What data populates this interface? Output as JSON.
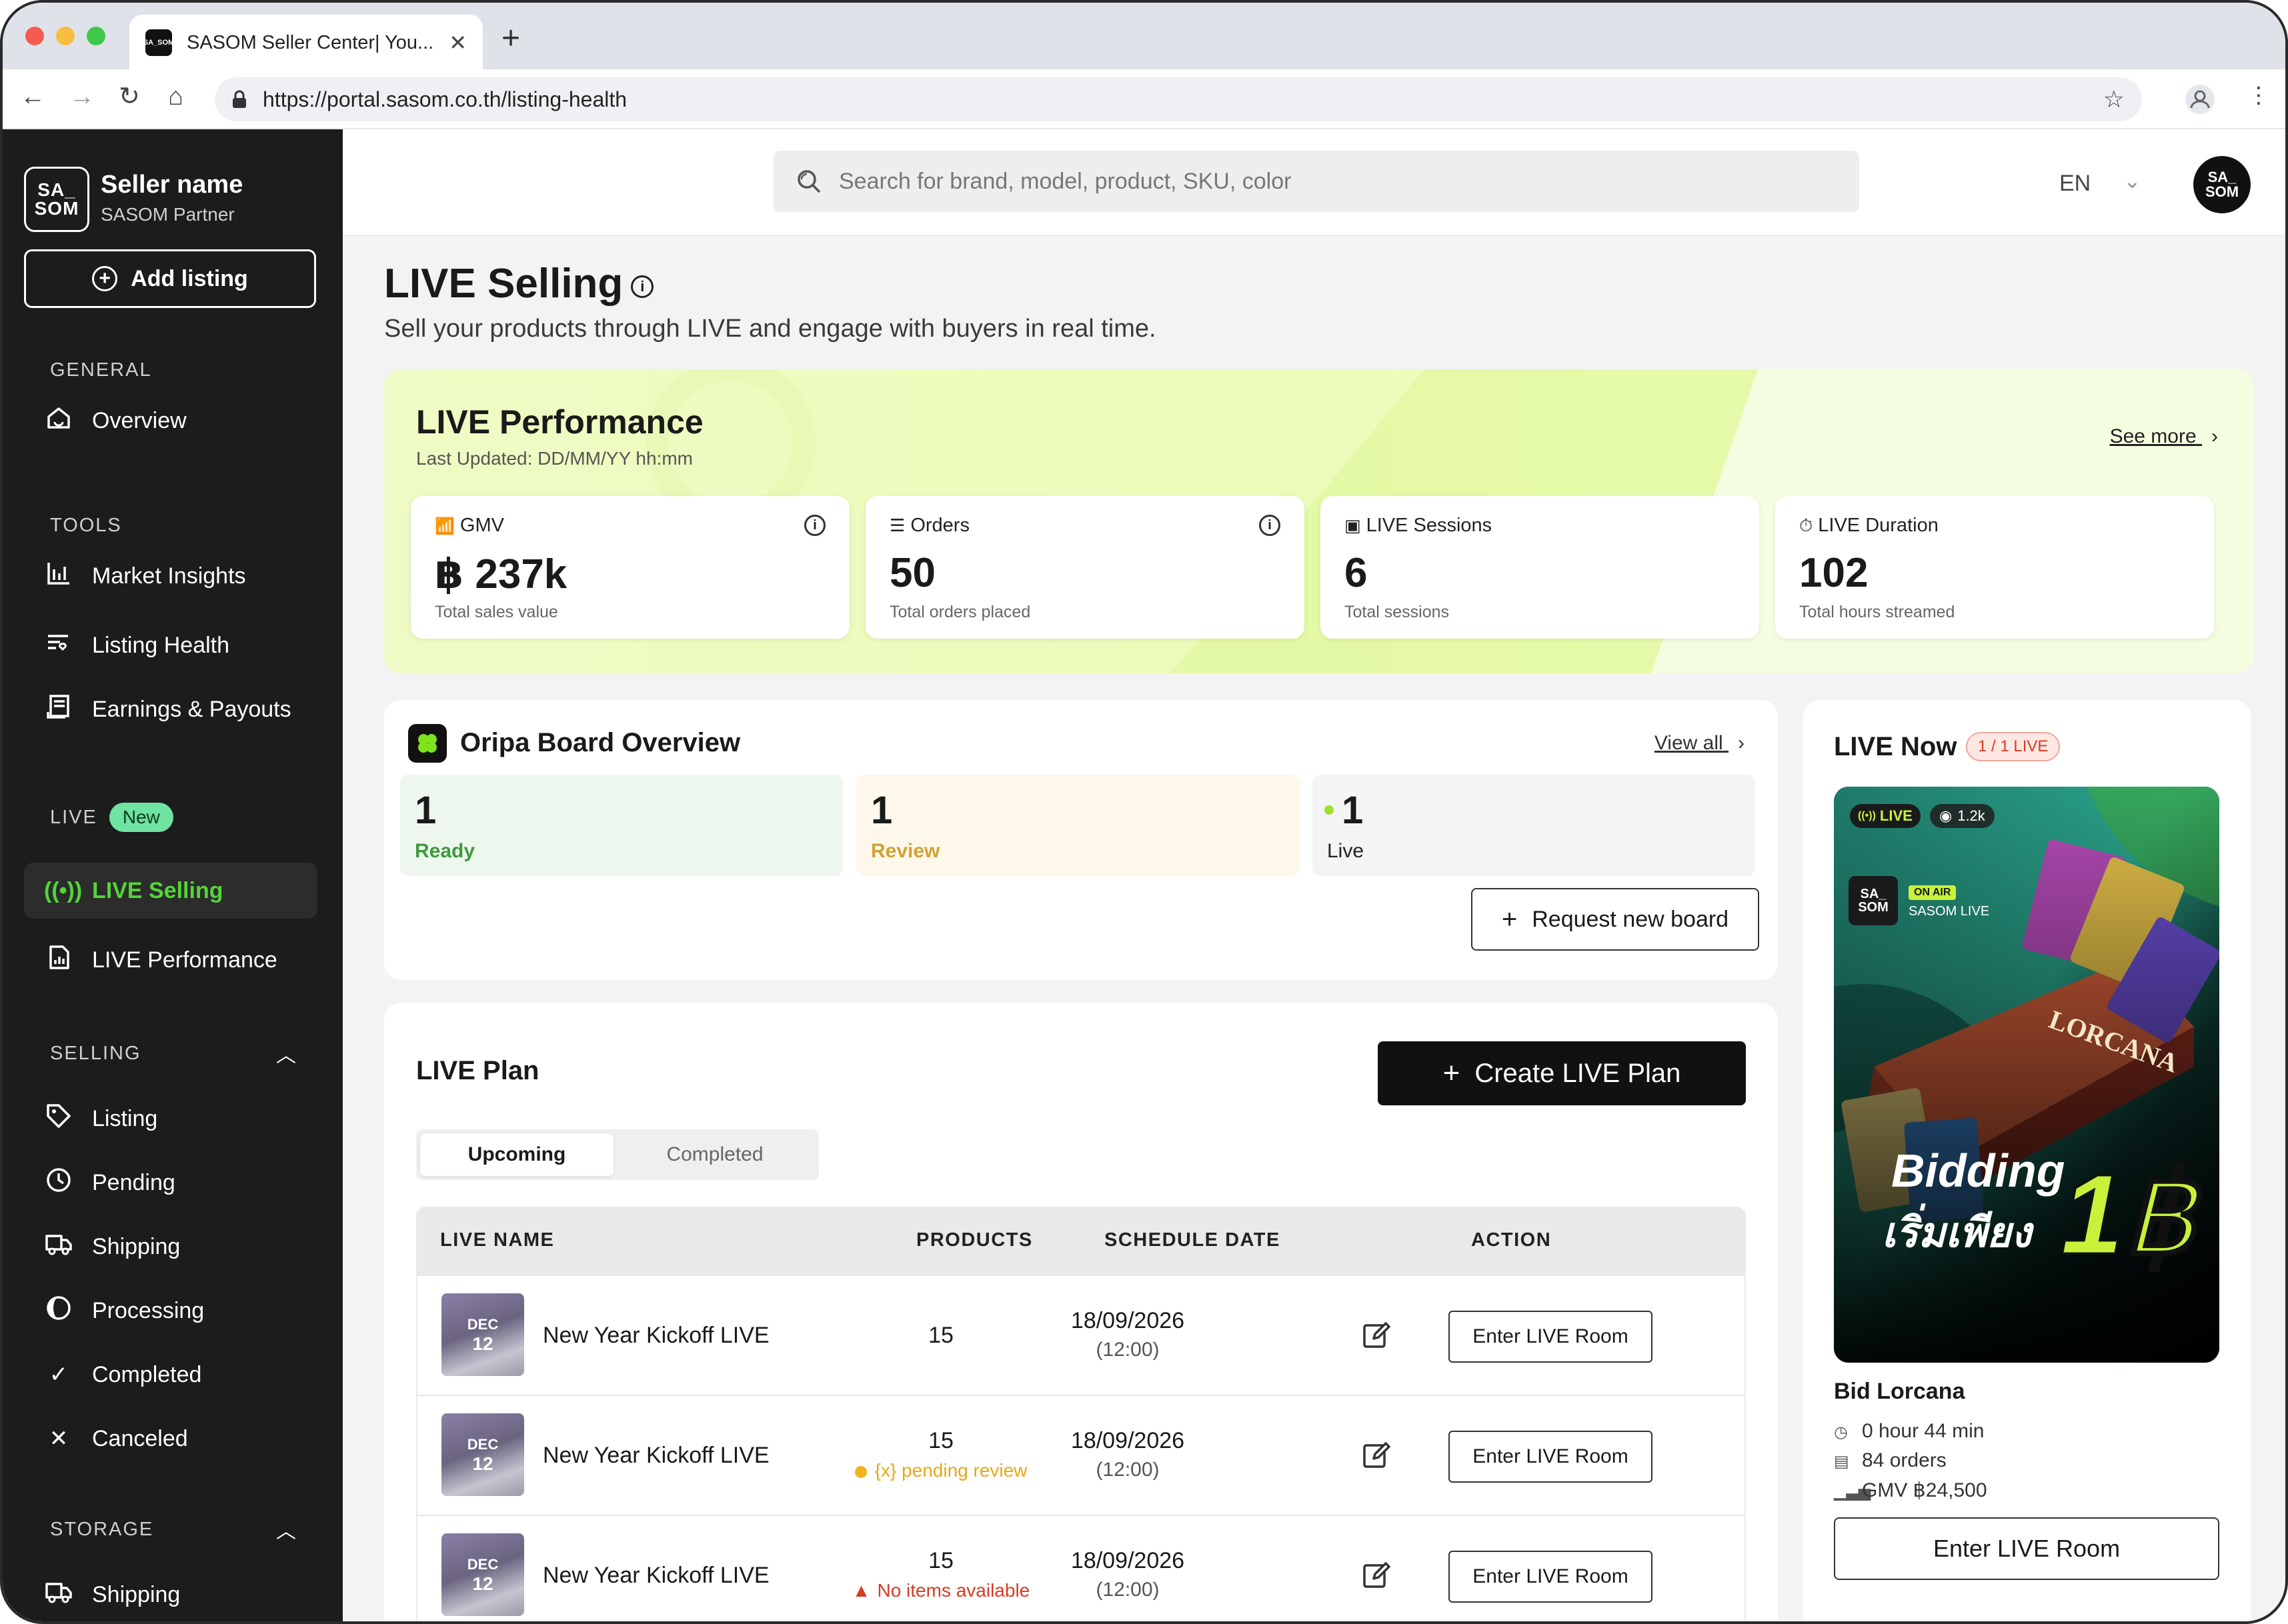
{
  "browser": {
    "tab_title": "SASOM Seller Center| You...",
    "url": "https://portal.sasom.co.th/listing-health",
    "favicon_text": "SA_SOM"
  },
  "sidebar": {
    "logo_text": "SA_ SOM",
    "seller_name": "Seller name",
    "seller_sub": "SASOM Partner",
    "add_listing": "Add listing",
    "sections": {
      "general": "GENERAL",
      "tools": "TOOLS",
      "live": "LIVE",
      "live_badge": "New",
      "selling": "SELLING",
      "storage": "STORAGE"
    },
    "items": {
      "overview": "Overview",
      "market_insights": "Market Insights",
      "listing_health": "Listing Health",
      "earnings": "Earnings & Payouts",
      "live_selling": "LIVE Selling",
      "live_performance": "LIVE Performance",
      "listing": "Listing",
      "pending": "Pending",
      "shipping": "Shipping",
      "processing": "Processing",
      "completed": "Completed",
      "canceled": "Canceled",
      "storage_shipping": "Shipping"
    }
  },
  "header": {
    "search_placeholder": "Search for brand, model, product, SKU, color",
    "language": "EN",
    "avatar_text": "SA_ SOM"
  },
  "page": {
    "title": "LIVE Selling",
    "subtitle": "Sell your products through LIVE and engage with buyers in real time."
  },
  "performance": {
    "title": "LIVE Performance",
    "updated": "Last Updated: DD/MM/YY hh:mm",
    "see_more": "See more",
    "kpis": [
      {
        "label": "GMV",
        "value": "฿ 237k",
        "desc": "Total sales value"
      },
      {
        "label": "Orders",
        "value": "50",
        "desc": "Total orders placed"
      },
      {
        "label": "LIVE Sessions",
        "value": "6",
        "desc": "Total sessions"
      },
      {
        "label": "LIVE Duration",
        "value": "102",
        "desc": "Total hours streamed"
      }
    ]
  },
  "oripa": {
    "title": "Oripa Board Overview",
    "view_all": "View all",
    "stats": [
      {
        "count": "1",
        "label": "Ready"
      },
      {
        "count": "1",
        "label": "Review"
      },
      {
        "count": "1",
        "label": "Live"
      }
    ],
    "request_button": "Request new board"
  },
  "plan": {
    "title": "LIVE Plan",
    "create_button": "Create LIVE Plan",
    "tabs": [
      "Upcoming",
      "Completed"
    ],
    "columns": [
      "LIVE NAME",
      "PRODUCTS",
      "SCHEDULE DATE",
      "ACTION"
    ],
    "rows": [
      {
        "month": "DEC",
        "day": "12",
        "name": "New Year Kickoff LIVE",
        "products": "15",
        "note": "",
        "date": "18/09/2026",
        "time": "(12:00)",
        "action": "Enter LIVE Room"
      },
      {
        "month": "DEC",
        "day": "12",
        "name": "New Year Kickoff LIVE",
        "products": "15",
        "note": "{x} pending review",
        "date": "18/09/2026",
        "time": "(12:00)",
        "action": "Enter LIVE Room"
      },
      {
        "month": "DEC",
        "day": "12",
        "name": "New Year Kickoff LIVE",
        "products": "15",
        "note": "No items available",
        "date": "18/09/2026",
        "time": "(12:00)",
        "action": "Enter LIVE Room"
      }
    ]
  },
  "live_now": {
    "title": "LIVE Now",
    "badge": "1 / 1 LIVE",
    "live_tag": "LIVE",
    "viewers": "1.2k",
    "on_air": "ON AIR",
    "channel": "SASOM LIVE",
    "logo_text": "SA_ SOM",
    "image_lorcana": "LORCANA",
    "promo_line1": "Bidding",
    "promo_line2": "เริ่มเพียง",
    "promo_price": "1฿",
    "name": "Bid Lorcana",
    "duration": "0 hour 44 min",
    "orders": "84 orders",
    "gmv": "GMV ฿24,500",
    "button": "Enter LIVE Room"
  },
  "colors": {
    "sidebar_bg": "#1c1c1c",
    "accent_green": "#52d637",
    "ready_bg": "#eef7ee",
    "review_bg": "#fdf8ea",
    "live_bg": "#f4f4f4",
    "warning": "#e6a817",
    "error": "#d63b24"
  }
}
